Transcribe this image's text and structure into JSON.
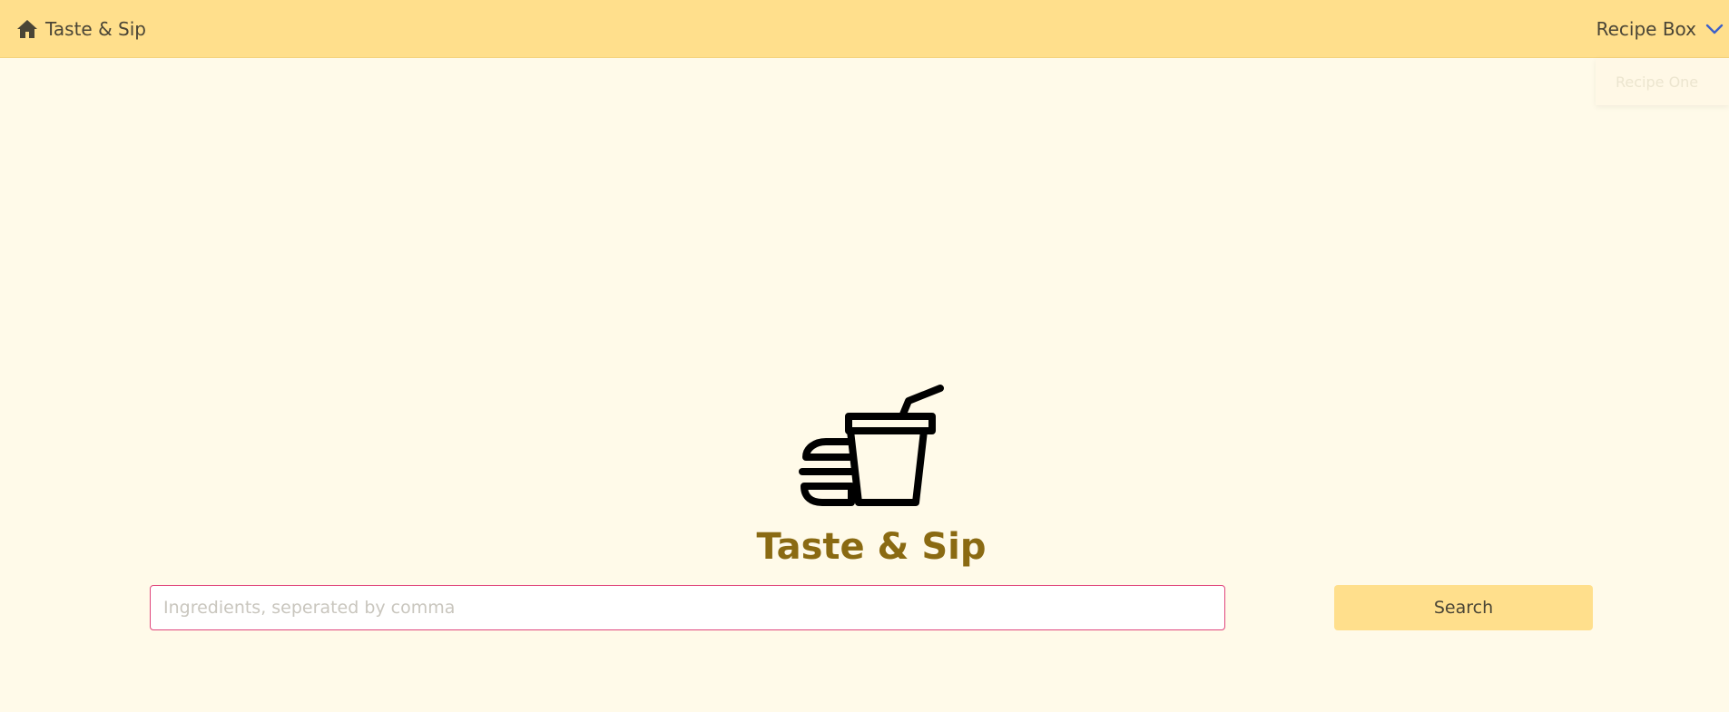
{
  "navbar": {
    "brand_label": "Taste & Sip",
    "brand_icon": "home-icon",
    "menu_label": "Recipe Box",
    "menu_icon": "chevron-down-icon",
    "dropdown_items": [
      {
        "label": "Recipe One"
      }
    ]
  },
  "hero": {
    "logo_icon": "burger-and-drink-icon",
    "title": "Taste & Sip"
  },
  "search": {
    "placeholder": "Ingredients, seperated by comma",
    "value": "",
    "button_label": "Search"
  },
  "colors": {
    "navbar_bg": "#ffdf8c",
    "page_bg": "#fffae9",
    "title": "#8a6a12",
    "input_border": "#e0457b",
    "chevron": "#3d5fc9"
  }
}
